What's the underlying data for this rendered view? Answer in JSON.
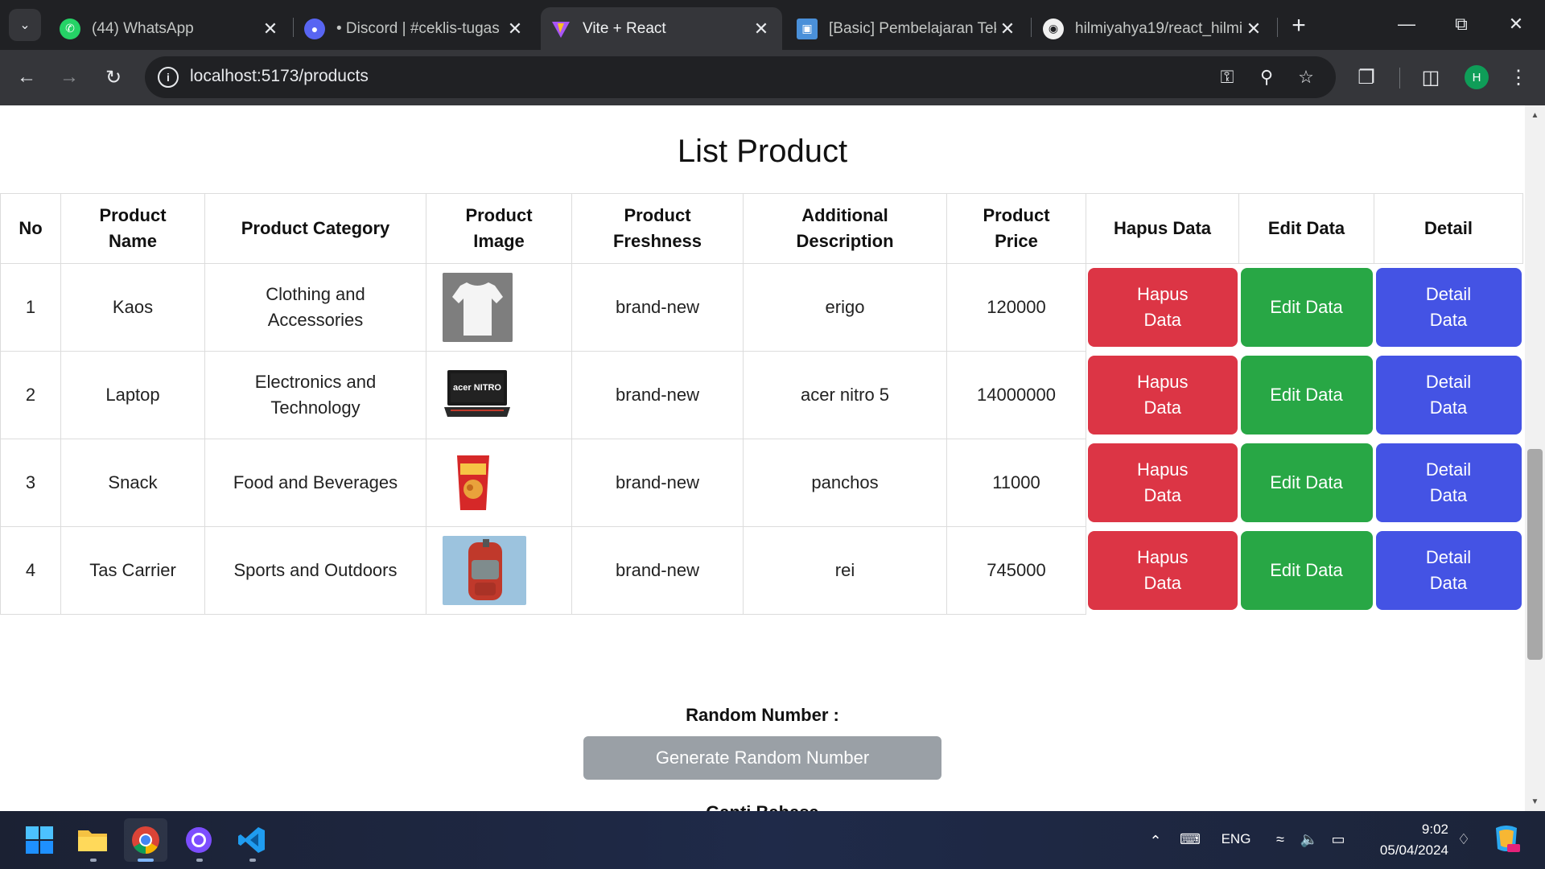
{
  "browser": {
    "tabs": [
      {
        "title": "(44) WhatsApp",
        "icon": "whatsapp-icon",
        "active": false
      },
      {
        "title": "• Discord | #ceklis-tugas",
        "icon": "discord-icon",
        "active": false
      },
      {
        "title": "Vite + React",
        "icon": "vite-icon",
        "active": true
      },
      {
        "title": "[Basic] Pembelajaran Tekn",
        "icon": "monitor-icon",
        "active": false
      },
      {
        "title": "hilmiyahya19/react_hilmi",
        "icon": "github-icon",
        "active": false
      }
    ],
    "url": "localhost:5173/products",
    "profile_initial": "H"
  },
  "page": {
    "title": "List Product",
    "table": {
      "headers": [
        "No",
        "Product Name",
        "Product Category",
        "Product Image",
        "Product Freshness",
        "Additional Description",
        "Product Price",
        "Hapus Data",
        "Edit Data",
        "Detail"
      ],
      "rows": [
        {
          "no": "1",
          "name": "Kaos",
          "category": "Clothing and Accessories",
          "image": "t-shirt-image",
          "freshness": "brand-new",
          "description": "erigo",
          "price": "120000"
        },
        {
          "no": "2",
          "name": "Laptop",
          "category": "Electronics and Technology",
          "image": "laptop-image",
          "image_text": "acer NITRO",
          "freshness": "brand-new",
          "description": "acer nitro 5",
          "price": "14000000"
        },
        {
          "no": "3",
          "name": "Snack",
          "category": "Food and Beverages",
          "image": "snack-image",
          "freshness": "brand-new",
          "description": "panchos",
          "price": "11000"
        },
        {
          "no": "4",
          "name": "Tas Carrier",
          "category": "Sports and Outdoors",
          "image": "backpack-image",
          "freshness": "brand-new",
          "description": "rei",
          "price": "745000"
        }
      ],
      "hapus_label": "Hapus Data",
      "edit_label": "Edit Data",
      "detail_label": "Detail Data"
    },
    "random_label": "Random Number :",
    "generate_button": "Generate Random Number",
    "cut_text": "Ganti Bahasa"
  },
  "taskbar": {
    "language": "ENG",
    "time": "9:02",
    "date": "05/04/2024"
  },
  "colors": {
    "hapus": "#dc3545",
    "edit": "#28a745",
    "detail": "#4453e4",
    "generate": "#9aa0a6"
  }
}
